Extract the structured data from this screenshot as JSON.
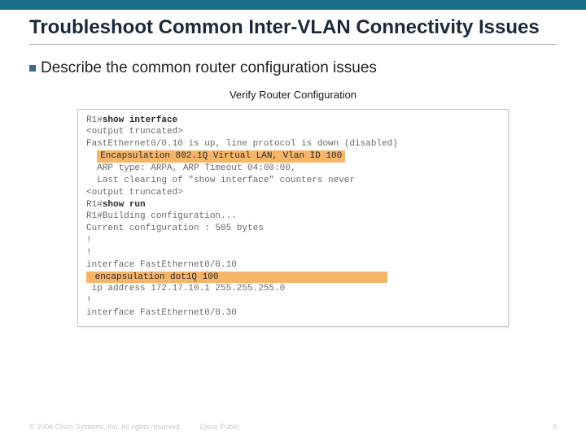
{
  "slide": {
    "title": "Troubleshoot Common Inter-VLAN Connectivity Issues",
    "bullet": "Describe the common router configuration issues"
  },
  "figure": {
    "title": "Verify Router Configuration",
    "lines": {
      "l1a": "R1#",
      "l1b": "show interface",
      "l2": "<output truncated>",
      "l3": "FastEthernet0/0.10 is up, line protocol is down (disabled)",
      "l4": "Encapsulation 802.1Q Virtual LAN, Vlan ID 100",
      "l5": "  ARP type: ARPA, ARP Timeout 04:00:00,",
      "l6": "  Last clearing of \"show interface\" counters never",
      "l7": "<output truncated>",
      "l8a": "R1#",
      "l8b": "show run",
      "l9": "R1#Building configuration...",
      "l10": "Current configuration : 505 bytes",
      "l11": "!",
      "l12": "!",
      "l13": "interface FastEthernet0/0.10",
      "l14": " encapsulation dot1Q 100",
      "l15": " ip address 172.17.10.1 255.255.255.0",
      "l16": "!",
      "l17": "interface FastEthernet0/0.30"
    }
  },
  "footer": {
    "copyright": "© 2006 Cisco Systems, Inc. All rights reserved.",
    "scope": "Cisco Public",
    "page": "8"
  }
}
